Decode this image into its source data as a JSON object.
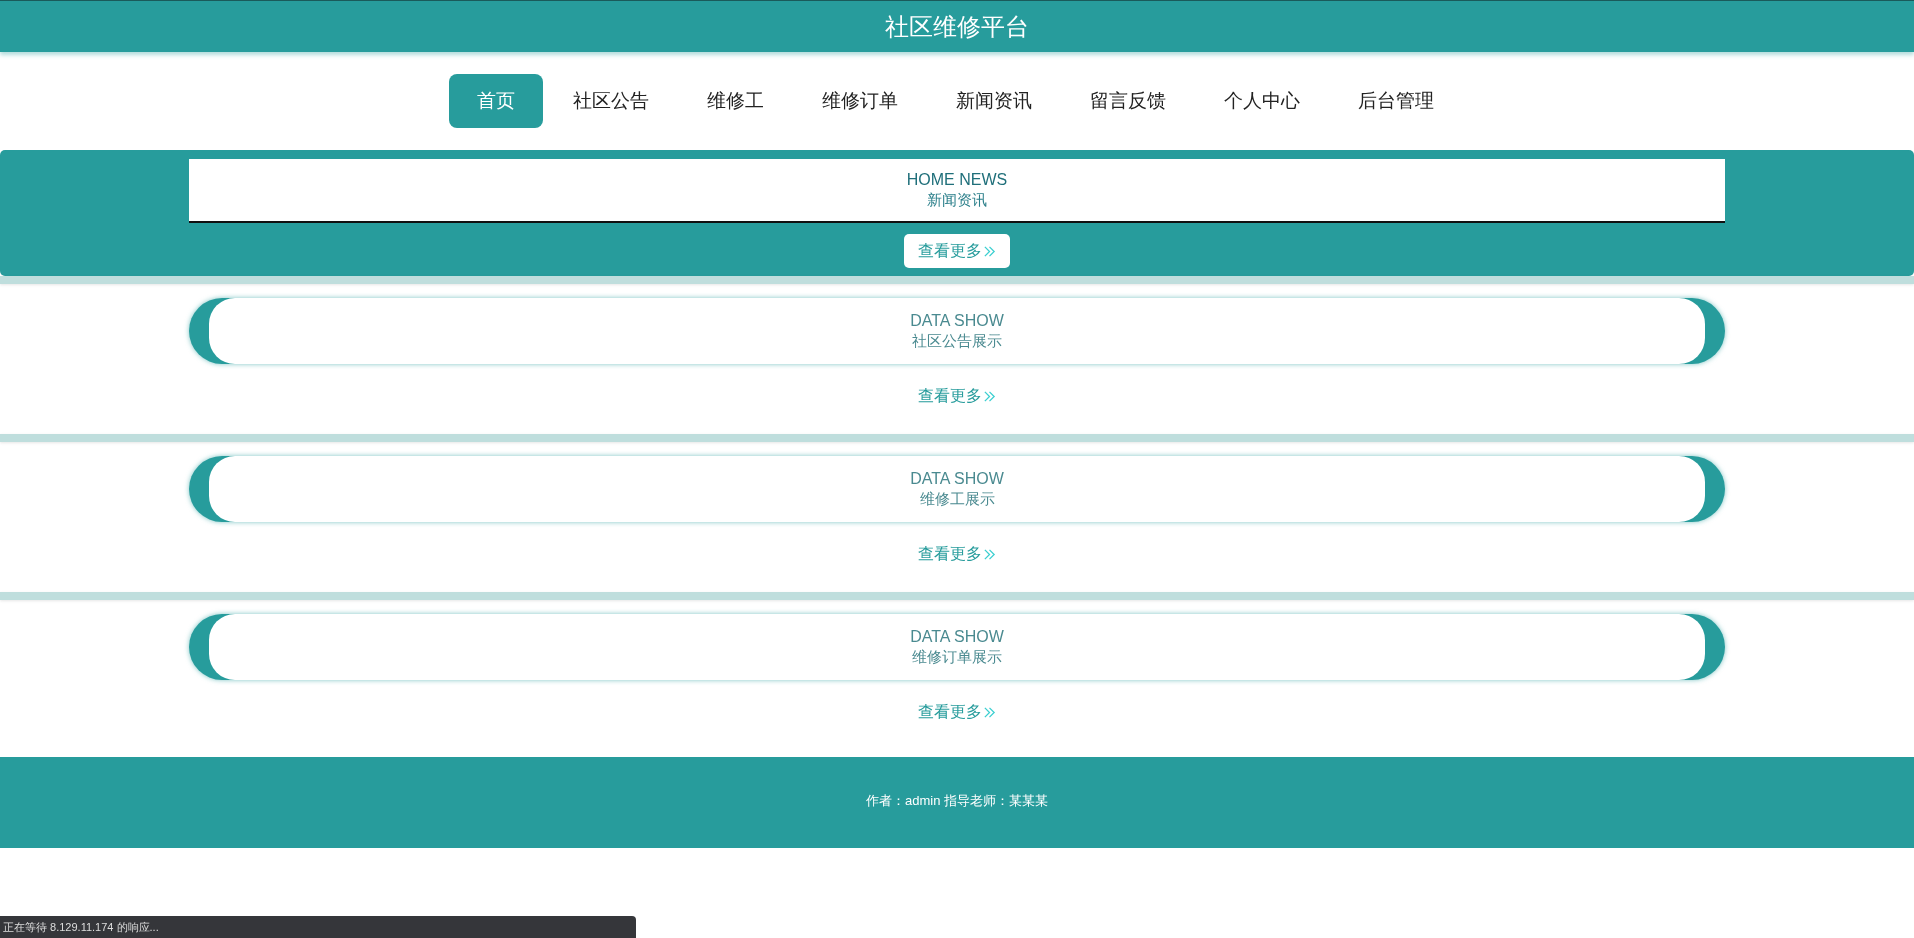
{
  "header": {
    "title": "社区维修平台"
  },
  "nav": [
    {
      "label": "首页",
      "selected": true
    },
    {
      "label": "社区公告",
      "selected": false
    },
    {
      "label": "维修工",
      "selected": false
    },
    {
      "label": "维修订单",
      "selected": false
    },
    {
      "label": "新闻资讯",
      "selected": false
    },
    {
      "label": "留言反馈",
      "selected": false
    },
    {
      "label": "个人中心",
      "selected": false
    },
    {
      "label": "后台管理",
      "selected": false
    }
  ],
  "news": {
    "title_en": "HOME NEWS",
    "title": "新闻资讯",
    "more": "查看更多"
  },
  "sections": [
    {
      "title_en": "DATA SHOW",
      "title": "社区公告展示",
      "more": "查看更多"
    },
    {
      "title_en": "DATA SHOW",
      "title": "维修工展示",
      "more": "查看更多"
    },
    {
      "title_en": "DATA SHOW",
      "title": "维修订单展示",
      "more": "查看更多"
    }
  ],
  "footer": {
    "text": "作者：admin 指导老师：某某某"
  },
  "status_bar": {
    "text": "正在等待 8.129.11.174 的响应..."
  }
}
